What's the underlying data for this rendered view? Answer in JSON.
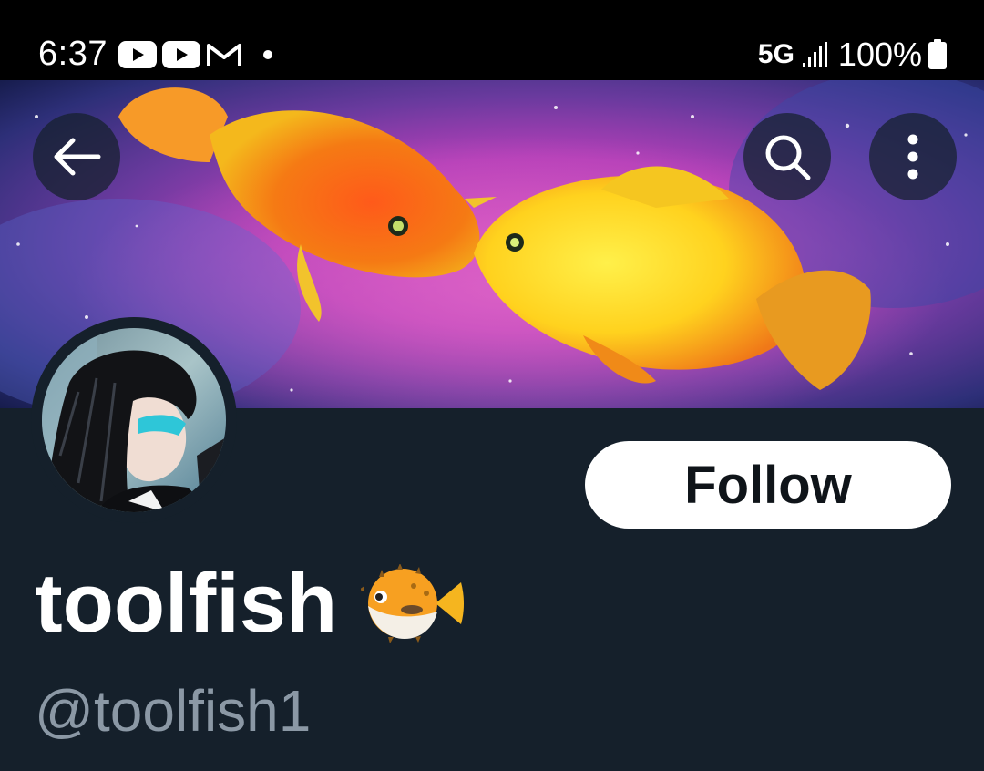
{
  "status_bar": {
    "time": "6:37",
    "notification_icons": [
      "youtube-icon",
      "youtube-icon",
      "gmail-icon",
      "dot-icon"
    ],
    "network": "5G",
    "battery_percent": "100%"
  },
  "header": {
    "back_icon": "arrow-left-icon",
    "search_icon": "search-icon",
    "more_icon": "more-vertical-icon"
  },
  "banner": {
    "description_icon": "banner-image"
  },
  "profile": {
    "display_name": "toolfish",
    "name_emoji": "blowfish-emoji",
    "handle": "@toolfish1",
    "follow_label": "Follow"
  },
  "colors": {
    "background": "#15202b",
    "handle_text": "#8b98a5",
    "follow_bg": "#ffffff",
    "follow_text": "#0f1419"
  }
}
